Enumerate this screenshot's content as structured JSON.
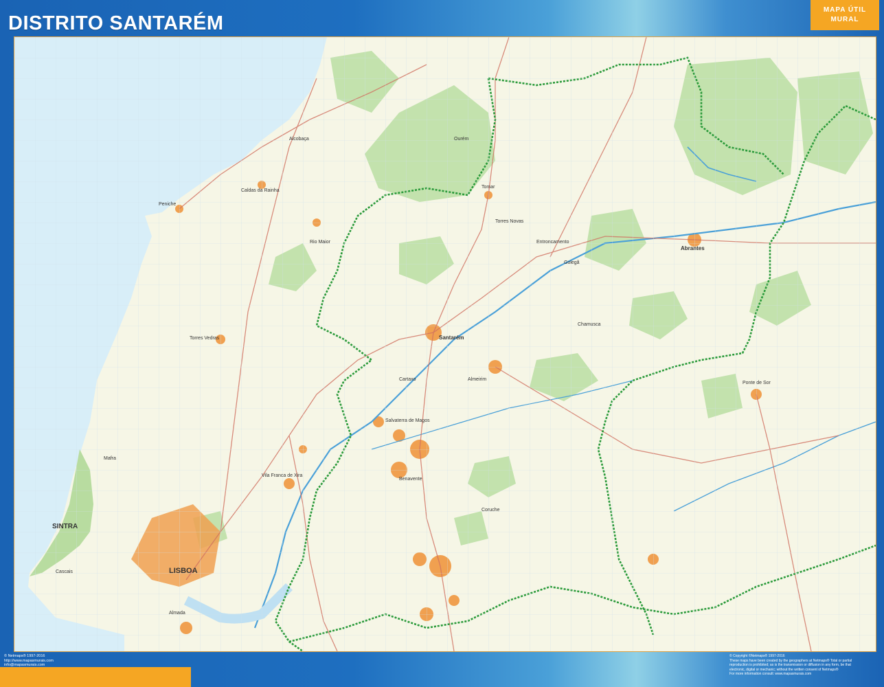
{
  "header": {
    "title": "DISTRITO SANTARÉM",
    "badge_line1": "MAPA ÚTIL",
    "badge_line2": "MURAL"
  },
  "map": {
    "labels": {
      "lisboa": "LISBOA",
      "sintra": "SINTRA",
      "santarem": "Santarém",
      "abrantes": "Abrantes",
      "tomar": "Tomar",
      "torres_novas": "Torres Novas",
      "entroncamento": "Entroncamento",
      "cartaxo": "Cartaxo",
      "almeirim": "Almeirim",
      "coruche": "Coruche",
      "benavente": "Benavente",
      "salvaterra": "Salvaterra de Magos",
      "chamusca": "Chamusca",
      "golega": "Golegã",
      "rio_maior": "Rio Maior",
      "alcobaca": "Alcobaça",
      "caldas": "Caldas da Rainha",
      "peniche": "Peniche",
      "torres_vedras": "Torres Vedras",
      "vila_franca": "Vila Franca de Xira",
      "ponte_de_sor": "Ponte de Sor",
      "cascais": "Cascais",
      "mafra": "Mafra",
      "ourem": "Ourém",
      "almada": "Almada"
    }
  },
  "footer": {
    "left_line1": "© Netmaps® 1997-2016",
    "left_line2": "http://www.mapasmurais.com",
    "left_line3": "info@mapasmurais.com",
    "right_line1": "© Copyright ©Netmaps® 1997-2016",
    "right_line2": "These maps have been created by the geographers at Netmaps® Total or partial",
    "right_line3": "reproduction is prohibited; as is the transmission or diffusion in any form, be that",
    "right_line4": "electronic, digital or mechanic; without the written consent of Netmaps®",
    "right_line5": "For more information consult: www.mapasmurais.com"
  },
  "colors": {
    "header_blue": "#1a63b4",
    "accent_orange": "#f5a623",
    "sea": "#d8eef8",
    "land": "#f6f6e6",
    "forest": "#b8dca0",
    "urban": "#f0a050",
    "road": "#d07060",
    "border": "#2a9a3a",
    "river": "#4aa0d8"
  }
}
